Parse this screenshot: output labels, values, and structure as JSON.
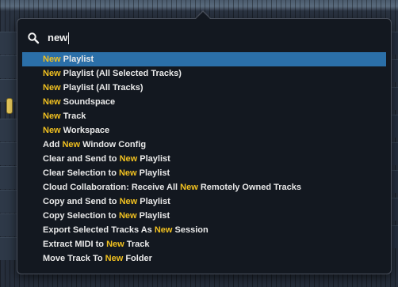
{
  "search": {
    "query": "new",
    "icon": "search-icon"
  },
  "colors": {
    "highlight_text": "#f0c020",
    "selected_background": "#2b6fa8",
    "popup_background": "#131820"
  },
  "selected_index": 0,
  "results": [
    {
      "segments": [
        {
          "text": "New",
          "hl": true
        },
        {
          "text": " Playlist",
          "hl": false
        }
      ]
    },
    {
      "segments": [
        {
          "text": "New",
          "hl": true
        },
        {
          "text": " Playlist (All Selected Tracks)",
          "hl": false
        }
      ]
    },
    {
      "segments": [
        {
          "text": "New",
          "hl": true
        },
        {
          "text": " Playlist (All Tracks)",
          "hl": false
        }
      ]
    },
    {
      "segments": [
        {
          "text": "New",
          "hl": true
        },
        {
          "text": " Soundspace",
          "hl": false
        }
      ]
    },
    {
      "segments": [
        {
          "text": "New",
          "hl": true
        },
        {
          "text": " Track",
          "hl": false
        }
      ]
    },
    {
      "segments": [
        {
          "text": "New",
          "hl": true
        },
        {
          "text": " Workspace",
          "hl": false
        }
      ]
    },
    {
      "segments": [
        {
          "text": "Add ",
          "hl": false
        },
        {
          "text": "New",
          "hl": true
        },
        {
          "text": " Window Config",
          "hl": false
        }
      ]
    },
    {
      "segments": [
        {
          "text": "Clear and Send to ",
          "hl": false
        },
        {
          "text": "New",
          "hl": true
        },
        {
          "text": " Playlist",
          "hl": false
        }
      ]
    },
    {
      "segments": [
        {
          "text": "Clear Selection to ",
          "hl": false
        },
        {
          "text": "New",
          "hl": true
        },
        {
          "text": " Playlist",
          "hl": false
        }
      ]
    },
    {
      "segments": [
        {
          "text": "Cloud Collaboration: Receive All ",
          "hl": false
        },
        {
          "text": "New",
          "hl": true
        },
        {
          "text": " Remotely Owned Tracks",
          "hl": false
        }
      ]
    },
    {
      "segments": [
        {
          "text": "Copy and Send to ",
          "hl": false
        },
        {
          "text": "New",
          "hl": true
        },
        {
          "text": " Playlist",
          "hl": false
        }
      ]
    },
    {
      "segments": [
        {
          "text": "Copy Selection to ",
          "hl": false
        },
        {
          "text": "New",
          "hl": true
        },
        {
          "text": " Playlist",
          "hl": false
        }
      ]
    },
    {
      "segments": [
        {
          "text": "Export Selected Tracks As ",
          "hl": false
        },
        {
          "text": "New",
          "hl": true
        },
        {
          "text": " Session",
          "hl": false
        }
      ]
    },
    {
      "segments": [
        {
          "text": "Extract MIDI to ",
          "hl": false
        },
        {
          "text": "New",
          "hl": true
        },
        {
          "text": " Track",
          "hl": false
        }
      ]
    },
    {
      "segments": [
        {
          "text": "Move Track To ",
          "hl": false
        },
        {
          "text": "New",
          "hl": true
        },
        {
          "text": " Folder",
          "hl": false
        }
      ]
    }
  ]
}
